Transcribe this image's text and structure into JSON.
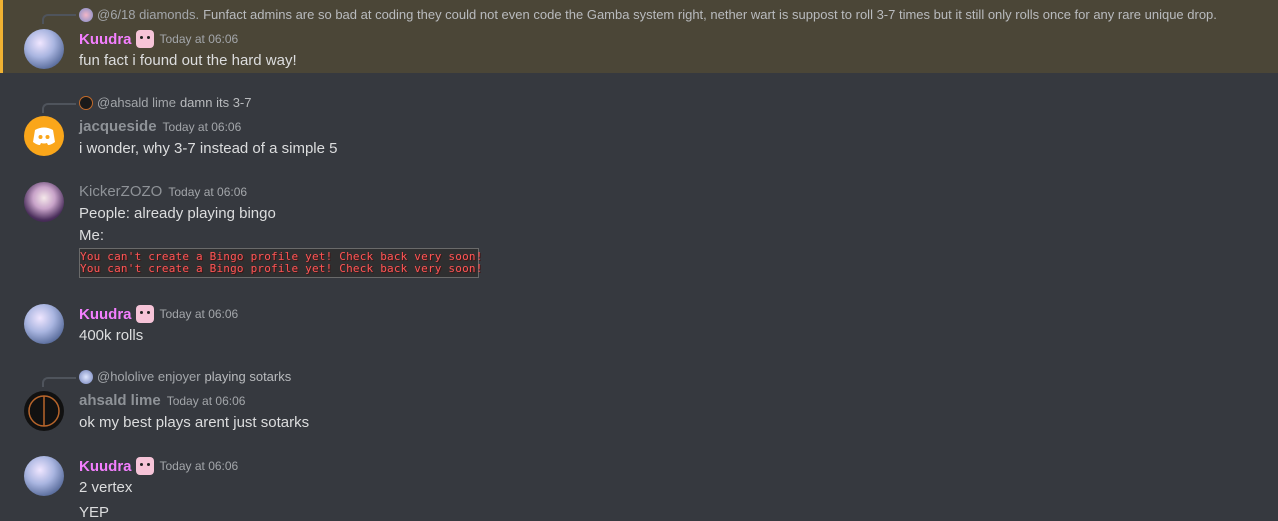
{
  "messages": [
    {
      "reply_to": {
        "name": "@6/18 diamonds.",
        "text": "Funfact admins are so bad at coding they could not even code the Gamba system right, nether wart is suppost to roll 3-7 times but it still only rolls once for any rare unique drop."
      },
      "author": "Kuudra",
      "author_color": "#f47fff",
      "timestamp": "Today at 06:06",
      "lines": [
        "fun fact i found out the hard way!"
      ],
      "highlighted": true
    },
    {
      "reply_to": {
        "name": "@ahsald lime",
        "text": "damn its 3-7"
      },
      "author": "jacqueside",
      "author_color": "#8e9297",
      "timestamp": "Today at 06:06",
      "lines": [
        "i wonder, why 3-7 instead of a simple 5"
      ]
    },
    {
      "author": "KickerZOZO",
      "author_color": "#8e9297",
      "timestamp": "Today at 06:06",
      "lines": [
        "People: already playing bingo",
        "Me:"
      ],
      "attachment_lines": [
        "You can't create a Bingo profile yet! Check back very soon!",
        "You can't create a Bingo profile yet! Check back very soon!"
      ]
    },
    {
      "author": "Kuudra",
      "author_color": "#f47fff",
      "timestamp": "Today at 06:06",
      "lines": [
        "400k rolls"
      ]
    },
    {
      "reply_to": {
        "name": "@hololive enjoyer",
        "text": "playing sotarks"
      },
      "author": "ahsald lime",
      "author_color": "#8e9297",
      "timestamp": "Today at 06:06",
      "lines": [
        "ok my best plays arent just sotarks"
      ]
    },
    {
      "author": "Kuudra",
      "author_color": "#f47fff",
      "timestamp": "Today at 06:06",
      "lines": [
        "2 vertex",
        "YEP"
      ]
    }
  ],
  "colors": {
    "background": "#36393f",
    "highlight": "#4b4637",
    "highlight_bar": "#f0b232",
    "discord_orange": "#faa61a"
  }
}
